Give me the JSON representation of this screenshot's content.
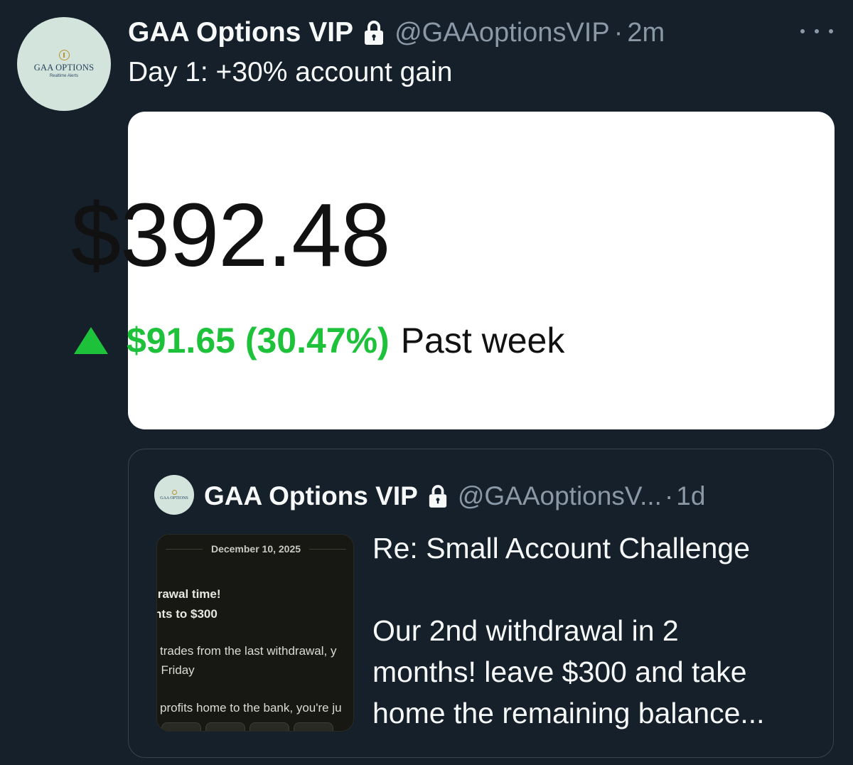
{
  "tweet": {
    "display_name": "GAA Options VIP",
    "handle": "@GAAoptionsVIP",
    "separator": "·",
    "time": "2m",
    "text": "Day 1: +30% account gain",
    "avatar": {
      "brand": "GAA OPTIONS",
      "tagline": "Realtime Alerts"
    },
    "icons": {
      "lock": "lock-icon",
      "more": "more-horizontal-icon"
    }
  },
  "media": {
    "balance": "$392.48",
    "change_icon": "triangle-up-icon",
    "change_value": "$91.65 (30.47%)",
    "change_period": "Past week",
    "colors": {
      "gain": "#1ec23a",
      "text": "#111111"
    }
  },
  "quoted_tweet": {
    "display_name": "GAA Options VIP",
    "handle": "@GAAoptionsV...",
    "separator": "·",
    "time": "1d",
    "thumbnail": {
      "date": "December 10, 2025",
      "title_line1": "ırawal time!",
      "title_line2": "nts to $300",
      "body_line1": "trades from the last withdrawal, y",
      "body_line2": ": Friday",
      "body_line3": "profits home to the bank, you're ju"
    },
    "text_lines": [
      "Re: Small Account Challenge",
      "",
      "Our 2nd withdrawal in 2",
      "months! leave $300 and take",
      "home the remaining balance..."
    ]
  },
  "theme": {
    "background": "#15202b",
    "primary_text": "#f7f9f9",
    "secondary_text": "#8b98a5",
    "border": "#38444d"
  }
}
